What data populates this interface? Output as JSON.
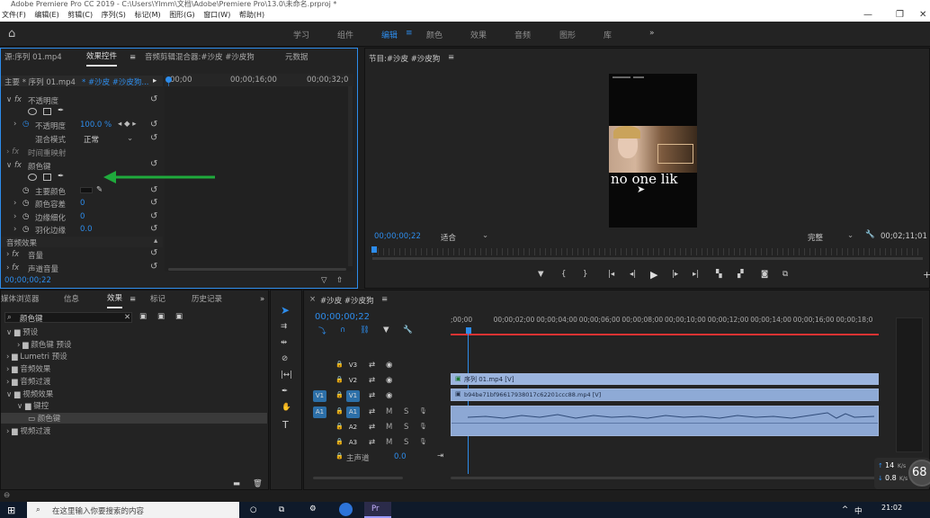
{
  "window": {
    "title": "Adobe Premiere Pro CC 2019 - C:\\Users\\Ylmm\\文档\\Adobe\\Premiere Pro\\13.0\\未命名.prproj *"
  },
  "menu": [
    "文件(F)",
    "编辑(E)",
    "剪辑(C)",
    "序列(S)",
    "标记(M)",
    "图形(G)",
    "窗口(W)",
    "帮助(H)"
  ],
  "workspaces": {
    "items": [
      "学习",
      "组件",
      "编辑",
      "颜色",
      "效果",
      "音频",
      "图形",
      "库"
    ],
    "active": "编辑",
    "more": "»"
  },
  "effect_controls": {
    "tabs": [
      "源:序列 01.mp4",
      "效果控件",
      "音频剪辑混合器:#沙皮 #沙皮狗",
      "元数据"
    ],
    "clip_header": "主要 * 序列 01.mp4",
    "clip_target": "* #沙皮 #沙皮狗...",
    "times": [
      "00;00",
      "00;00;16;00",
      "00;00;32;0"
    ],
    "opacity": {
      "section": "不透明度",
      "label": "不透明度",
      "value": "100.0 %",
      "blend_label": "混合模式",
      "blend_value": "正常"
    },
    "time_remap": "时间重映射",
    "color_key": {
      "section": "颜色键",
      "key_color_label": "主要颜色",
      "key_color": "#111111",
      "tolerance_label": "颜色容差",
      "tolerance": "0",
      "edge_thin_label": "边缘细化",
      "edge_thin": "0",
      "feather_label": "羽化边缘",
      "feather": "0.0"
    },
    "audio_effects": "音频效果",
    "volume": "音量",
    "channel_volume": "声道音量",
    "timecode": "00;00;00;22"
  },
  "program_monitor": {
    "title": "节目:#沙皮 #沙皮狗",
    "timecode": "00;00;00;22",
    "fit": "适合",
    "quality": "完整",
    "duration": "00;02;11;01",
    "caption": "no one lik"
  },
  "effects_panel": {
    "tabs": [
      "媒体浏览器",
      "信息",
      "效果",
      "标记",
      "历史记录"
    ],
    "search_value": "颜色键",
    "tree": [
      {
        "label": "预设",
        "level": 0,
        "open": true
      },
      {
        "label": "颜色键 预设",
        "level": 1,
        "open": false
      },
      {
        "label": "Lumetri 预设",
        "level": 0,
        "open": false
      },
      {
        "label": "音频效果",
        "level": 0,
        "open": false
      },
      {
        "label": "音频过渡",
        "level": 0,
        "open": false
      },
      {
        "label": "视频效果",
        "level": 0,
        "open": true
      },
      {
        "label": "键控",
        "level": 1,
        "open": true
      },
      {
        "label": "颜色键",
        "level": 2,
        "open": false
      },
      {
        "label": "视频过渡",
        "level": 0,
        "open": false
      }
    ]
  },
  "timeline": {
    "title": "#沙皮 #沙皮狗",
    "timecode": "00;00;00;22",
    "ruler": [
      ";00;00",
      "00;00;02;00",
      "00;00;04;00",
      "00;00;06;00",
      "00;00;08;00",
      "00;00;10;00",
      "00;00;12;00",
      "00;00;14;00",
      "00;00;16;00",
      "00;00;18;0"
    ],
    "tracks": [
      {
        "src": "",
        "name": "V3"
      },
      {
        "src": "",
        "name": "V2"
      },
      {
        "src": "V1",
        "name": "V1"
      },
      {
        "src": "A1",
        "name": "A1"
      },
      {
        "src": "",
        "name": "A2"
      },
      {
        "src": "",
        "name": "A3"
      }
    ],
    "master_label": "主声道",
    "master_value": "0.0",
    "clips": {
      "v2": "序列 01.mp4 [V]",
      "v1": "b94be71bf96617938017c62201ccc88.mp4 [V]"
    },
    "track_letters": {
      "mute": "M",
      "solo": "S"
    }
  },
  "network": {
    "up": "14",
    "down": "0.8",
    "unit": "K/s",
    "cpu": "68"
  },
  "taskbar": {
    "search_placeholder": "在这里输入你要搜索的内容",
    "time": "21:02",
    "ime": "中"
  }
}
